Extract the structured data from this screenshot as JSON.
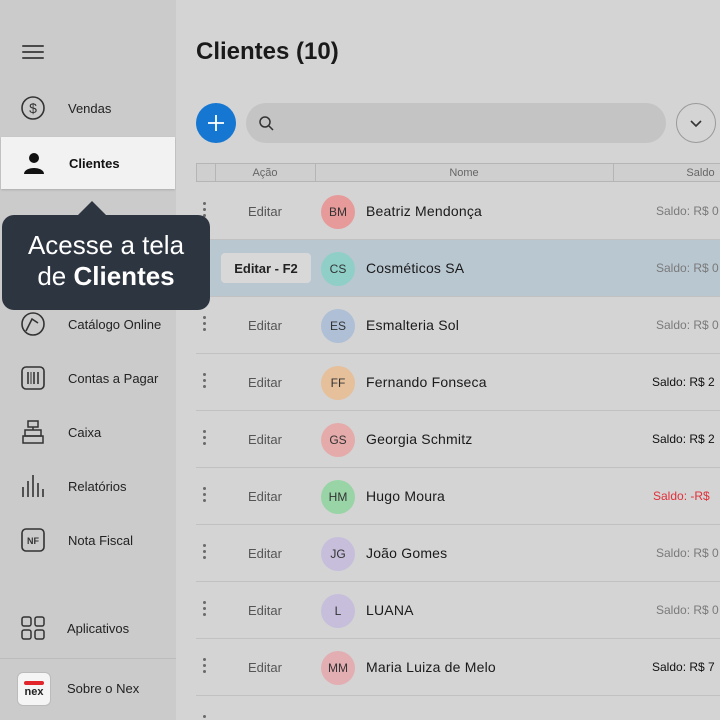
{
  "sidebar": {
    "items": [
      {
        "label": "Vendas",
        "icon": "dollar-circle-icon"
      },
      {
        "label": "Clientes",
        "icon": "user-icon"
      },
      {
        "label": "Catálogo Online",
        "icon": "catalog-icon"
      },
      {
        "label": "Contas a Pagar",
        "icon": "barcode-icon"
      },
      {
        "label": "Caixa",
        "icon": "cash-register-icon"
      },
      {
        "label": "Relatórios",
        "icon": "bar-chart-icon"
      },
      {
        "label": "Nota Fiscal",
        "icon": "nf-icon"
      },
      {
        "label": "Aplicativos",
        "icon": "apps-grid-icon"
      },
      {
        "label": "Sobre o Nex",
        "icon": "nex-logo"
      }
    ],
    "nf_icon_text": "NF",
    "logo_text": "nex"
  },
  "callout": {
    "line1": "Acesse a tela",
    "line2_prefix": "de ",
    "line2_bold": "Clientes"
  },
  "main": {
    "title": "Clientes (10)",
    "columns": [
      "Ação",
      "Nome",
      "Saldo"
    ],
    "rows": [
      {
        "action": "Editar",
        "initials": "BM",
        "name": "Beatriz Mendonça",
        "saldo": "Saldo: R$ 0",
        "avatar_color": "#e79a9a",
        "saldo_style": "muted"
      },
      {
        "action": "Editar - F2",
        "initials": "CS",
        "name": "Cosméticos SA",
        "saldo": "Saldo: R$ 0",
        "avatar_color": "#8fcfc7",
        "saldo_style": "muted",
        "selected": true
      },
      {
        "action": "Editar",
        "initials": "ES",
        "name": "Esmalteria Sol",
        "saldo": "Saldo: R$ 0",
        "avatar_color": "#aebfd6",
        "saldo_style": "muted"
      },
      {
        "action": "Editar",
        "initials": "FF",
        "name": "Fernando Fonseca",
        "saldo": "Saldo: R$ 2",
        "avatar_color": "#e6bf9b",
        "saldo_style": "pos"
      },
      {
        "action": "Editar",
        "initials": "GS",
        "name": "Georgia Schmitz",
        "saldo": "Saldo: R$ 2",
        "avatar_color": "#e5abab",
        "saldo_style": "pos"
      },
      {
        "action": "Editar",
        "initials": "HM",
        "name": "Hugo Moura",
        "saldo": "Saldo: -R$",
        "avatar_color": "#98d4a6",
        "saldo_style": "neg"
      },
      {
        "action": "Editar",
        "initials": "JG",
        "name": "João Gomes",
        "saldo": "Saldo: R$ 0",
        "avatar_color": "#c6bedb",
        "saldo_style": "muted"
      },
      {
        "action": "Editar",
        "initials": "L",
        "name": "LUANA",
        "saldo": "Saldo: R$ 0",
        "avatar_color": "#c6bedb",
        "saldo_style": "muted"
      },
      {
        "action": "Editar",
        "initials": "MM",
        "name": "Maria Luiza de Melo",
        "saldo": "Saldo: R$ 7",
        "avatar_color": "#e2aeb2",
        "saldo_style": "pos"
      }
    ]
  },
  "colors": {
    "accent": "#1677d2",
    "callout_bg": "#2d3540",
    "negative": "#e0303a",
    "selected_row": "#b9c7d1"
  }
}
